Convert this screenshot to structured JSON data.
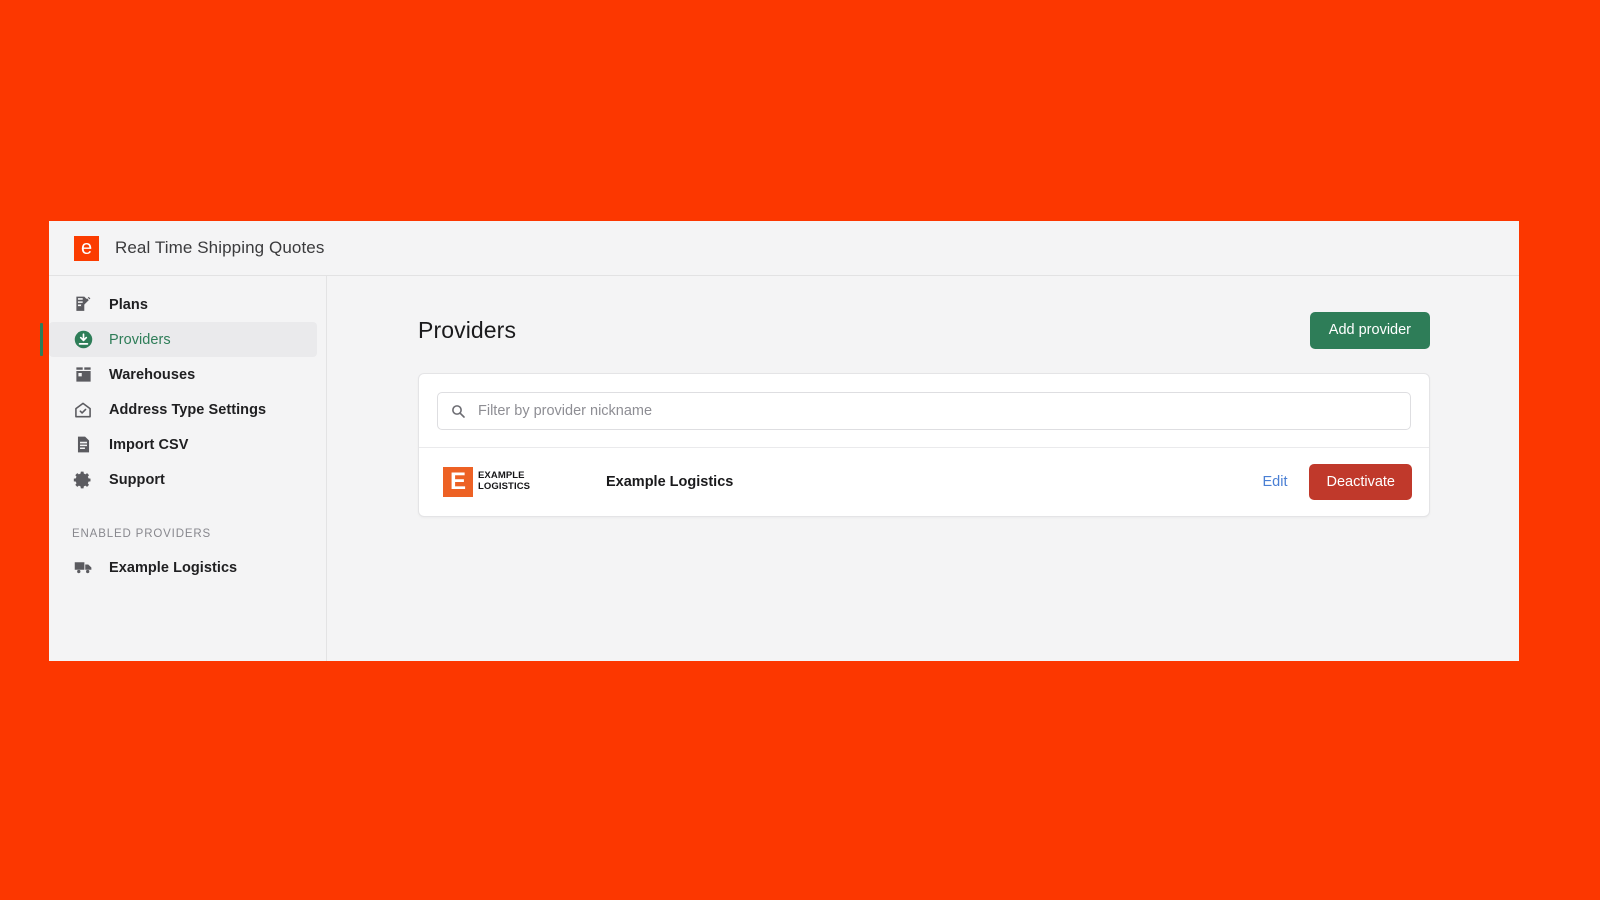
{
  "app": {
    "brand_letter": "e",
    "title": "Real Time Shipping Quotes"
  },
  "sidebar": {
    "items": [
      {
        "label": "Plans",
        "icon": "document-pencil-icon",
        "active": false
      },
      {
        "label": "Providers",
        "icon": "download-circle-icon",
        "active": true
      },
      {
        "label": "Warehouses",
        "icon": "box-icon",
        "active": false
      },
      {
        "label": "Address Type Settings",
        "icon": "home-check-icon",
        "active": false
      },
      {
        "label": "Import CSV",
        "icon": "document-icon",
        "active": false
      },
      {
        "label": "Support",
        "icon": "gear-icon",
        "active": false
      }
    ],
    "enabled_section_title": "ENABLED PROVIDERS",
    "enabled_providers": [
      {
        "label": "Example Logistics",
        "icon": "truck-icon"
      }
    ]
  },
  "main": {
    "page_title": "Providers",
    "add_provider_label": "Add provider",
    "search": {
      "placeholder": "Filter by provider nickname",
      "value": "",
      "icon": "search-icon"
    },
    "providers": [
      {
        "logo_letter": "E",
        "logo_line1": "EXAMPLE",
        "logo_line2": "LOGISTICS",
        "name": "Example Logistics",
        "edit_label": "Edit",
        "deactivate_label": "Deactivate"
      }
    ]
  },
  "colors": {
    "page_background": "#fc3700",
    "brand_orange": "#fb3c00",
    "accent_green": "#2e7d58",
    "danger_red": "#c0392b",
    "link_blue": "#4a7fd4",
    "provider_logo_orange": "#ed6124"
  }
}
